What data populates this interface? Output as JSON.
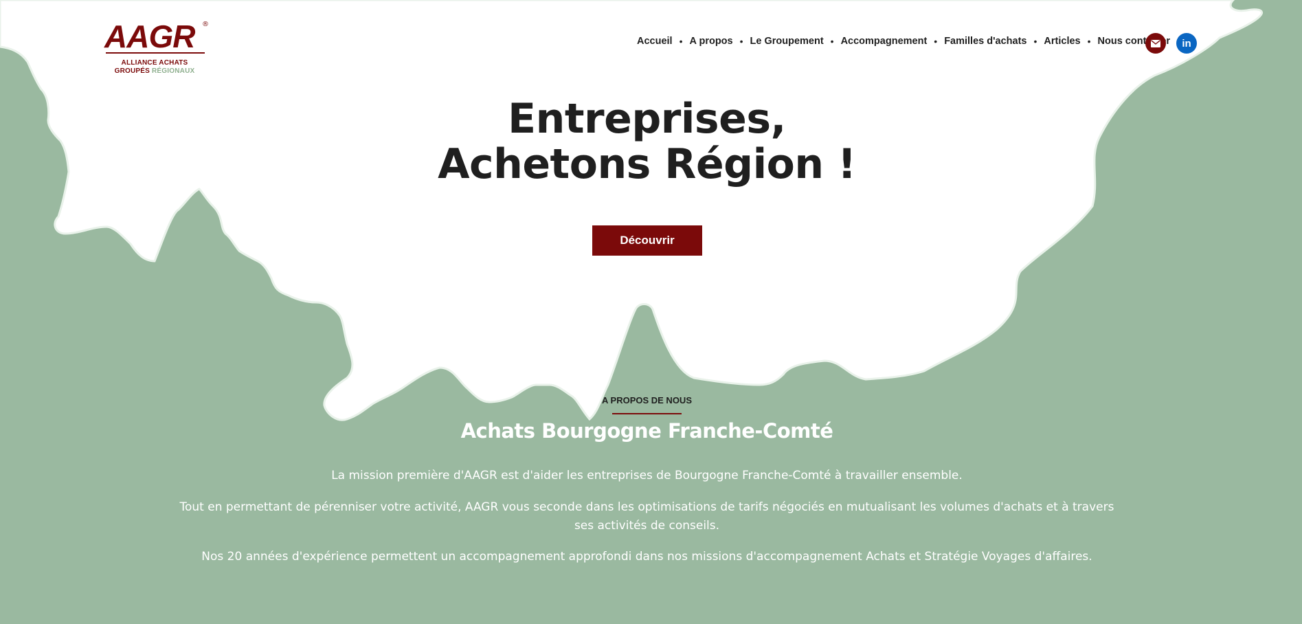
{
  "brand": {
    "logo_text": "AAGR",
    "logo_reg": "®",
    "tagline_line1": "ALLIANCE ACHATS",
    "tagline_line2_a": "GROUPÉS",
    "tagline_line2_b": "RÉGIONAUX"
  },
  "nav": {
    "items": [
      "Accueil",
      "A propos",
      "Le Groupement",
      "Accompagnement",
      "Familles d'achats",
      "Articles",
      "Nous contacter"
    ],
    "separator": "•"
  },
  "social": {
    "mail_icon": "mail-icon",
    "linkedin_label": "in"
  },
  "hero": {
    "title_line1": "Entreprises,",
    "title_line2": "Achetons Région !",
    "cta_label": "Découvrir"
  },
  "about": {
    "kicker": "A PROPOS DE NOUS",
    "title": "Achats Bourgogne Franche-Comté",
    "paragraphs": [
      "La mission première d'AAGR est d'aider les entreprises de Bourgogne Franche-Comté à travailler ensemble.",
      "Tout en permettant de pérenniser votre activité, AAGR vous seconde dans les optimisations de tarifs négociés en mutualisant les volumes d'achats et à travers ses activités de conseils.",
      "Nos 20 années d'expérience permettent un accompagnement approfondi dans nos missions d'accompagnement Achats et Stratégie Voyages d'affaires."
    ]
  },
  "colors": {
    "green": "#9ab9a0",
    "brand_red": "#7b0a0a",
    "linkedin_blue": "#0a66c2",
    "text_dark": "#1e1e1e"
  }
}
